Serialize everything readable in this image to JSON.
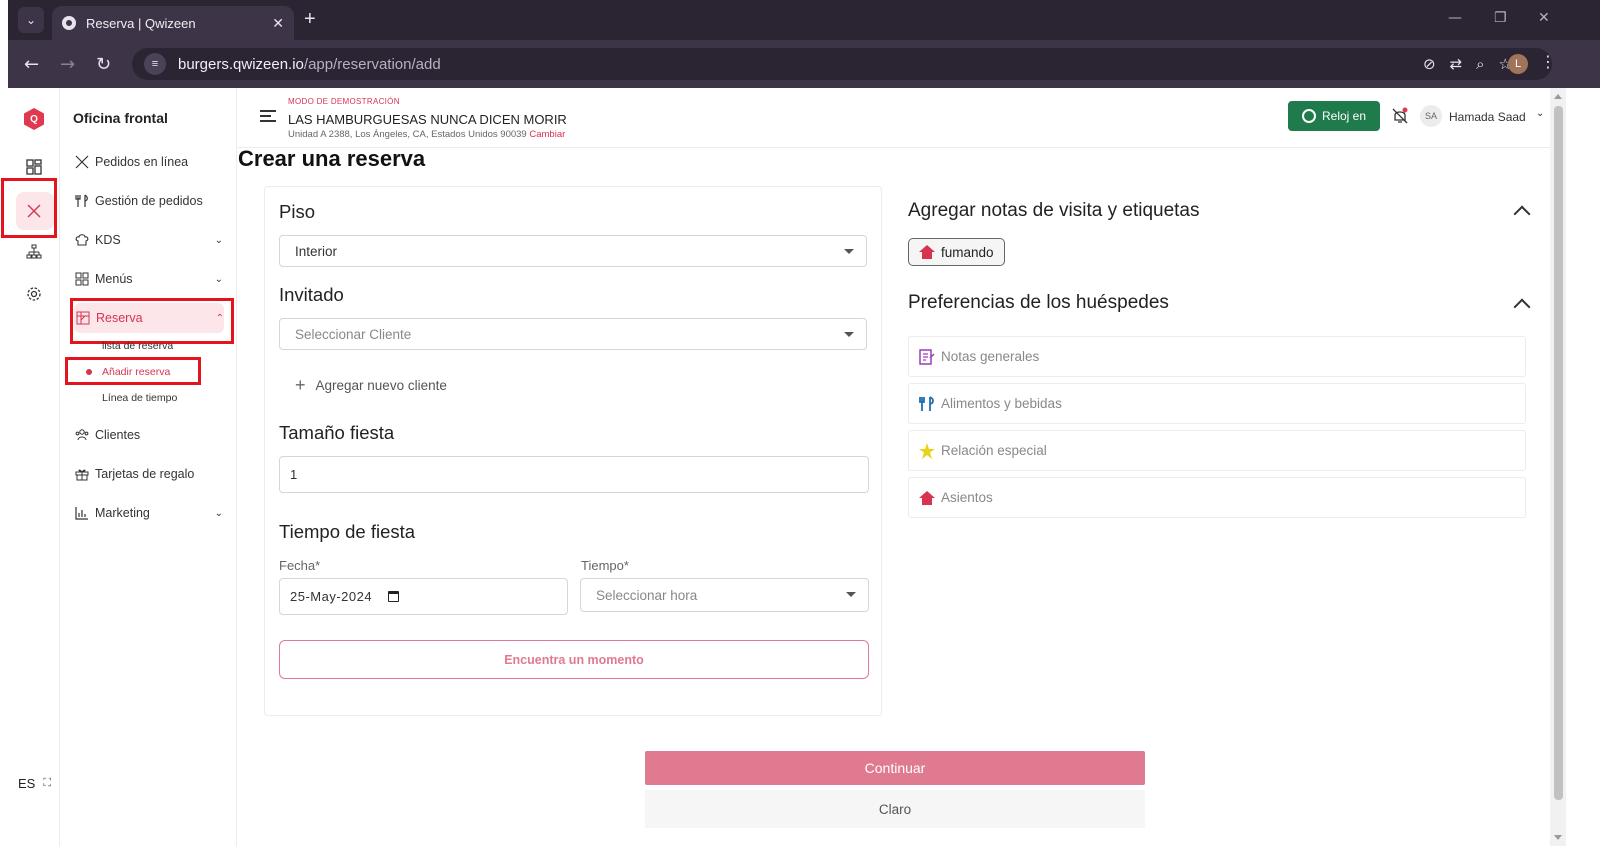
{
  "browser": {
    "tab_title": "Reserva | Qwizeen",
    "url_host": "burgers.qwizeen.io",
    "url_path": "/app/reservation/add",
    "profile_initial": "L"
  },
  "rail": {
    "lang": "ES"
  },
  "sidemenu": {
    "heading": "Oficina frontal",
    "items": [
      {
        "label": "Pedidos en línea"
      },
      {
        "label": "Gestión de pedidos"
      },
      {
        "label": "KDS"
      },
      {
        "label": "Menús"
      },
      {
        "label": "Reserva"
      },
      {
        "label": "Clientes"
      },
      {
        "label": "Tarjetas de regalo"
      },
      {
        "label": "Marketing"
      }
    ],
    "submenu": [
      {
        "label": "lista de reserva"
      },
      {
        "label": "Añadir reserva"
      },
      {
        "label": "Línea de tiempo"
      }
    ]
  },
  "header": {
    "demo_mode": "MODO DE DEMOSTRACIÓN",
    "restaurant": "LAS HAMBURGUESAS NUNCA DICEN MORIR",
    "address": "Unidad A 2388, Los Ángeles, CA, Estados Unidos 90039",
    "change": "Cambiar",
    "clock_label": "Reloj en",
    "avatar_initials": "SA",
    "user_name": "Hamada Saad"
  },
  "page": {
    "title": "Crear una reserva"
  },
  "form": {
    "floor_label": "Piso",
    "floor_value": "Interior",
    "guest_label": "Invitado",
    "guest_placeholder": "Seleccionar Cliente",
    "add_customer": "Agregar nuevo cliente",
    "party_size_label": "Tamaño fiesta",
    "party_size_value": "1",
    "party_time_label": "Tiempo de fiesta",
    "date_label": "Fecha*",
    "date_value": "25-May-2024",
    "time_label": "Tiempo*",
    "time_placeholder": "Seleccionar hora",
    "find_button": "Encuentra un momento"
  },
  "right": {
    "notes_heading": "Agregar notas de visita y etiquetas",
    "tag": "fumando",
    "prefs_heading": "Preferencias de los huéspedes",
    "prefs": [
      {
        "label": "Notas generales"
      },
      {
        "label": "Alimentos y bebidas"
      },
      {
        "label": "Relación especial"
      },
      {
        "label": "Asientos"
      }
    ]
  },
  "actions": {
    "continue": "Continuar",
    "clear": "Claro"
  },
  "colors": {
    "accent": "#d63451",
    "accent_light": "#e07a90",
    "clock_green": "#1f7a4c",
    "highlight_box": "#e3141e"
  }
}
